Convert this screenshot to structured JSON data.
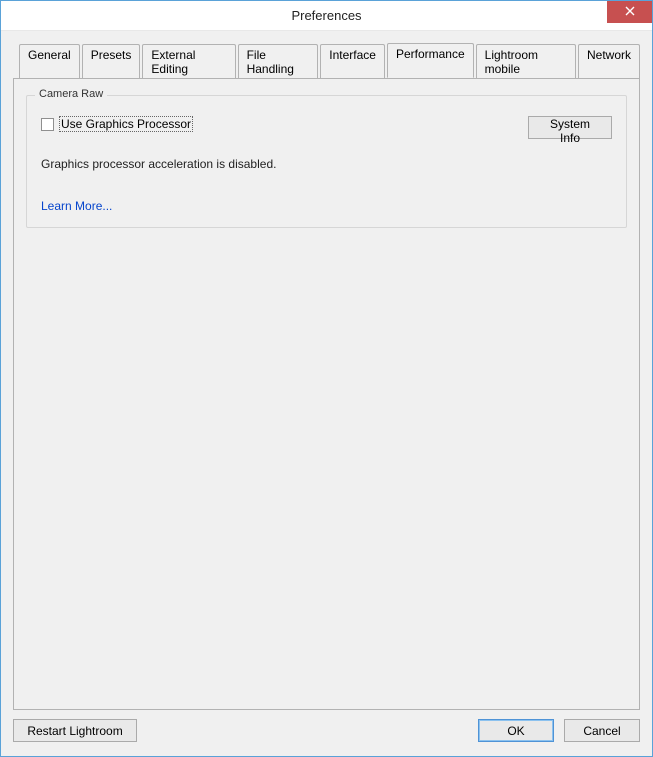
{
  "window": {
    "title": "Preferences"
  },
  "tabs": [
    {
      "label": "General"
    },
    {
      "label": "Presets"
    },
    {
      "label": "External Editing"
    },
    {
      "label": "File Handling"
    },
    {
      "label": "Interface"
    },
    {
      "label": "Performance",
      "active": true
    },
    {
      "label": "Lightroom mobile"
    },
    {
      "label": "Network"
    }
  ],
  "camera_raw": {
    "group_title": "Camera Raw",
    "use_gpu_label": "Use Graphics Processor",
    "use_gpu_checked": false,
    "system_info_btn": "System Info",
    "status_text": "Graphics processor acceleration is disabled.",
    "learn_more": "Learn More..."
  },
  "footer": {
    "restart": "Restart Lightroom",
    "ok": "OK",
    "cancel": "Cancel"
  }
}
